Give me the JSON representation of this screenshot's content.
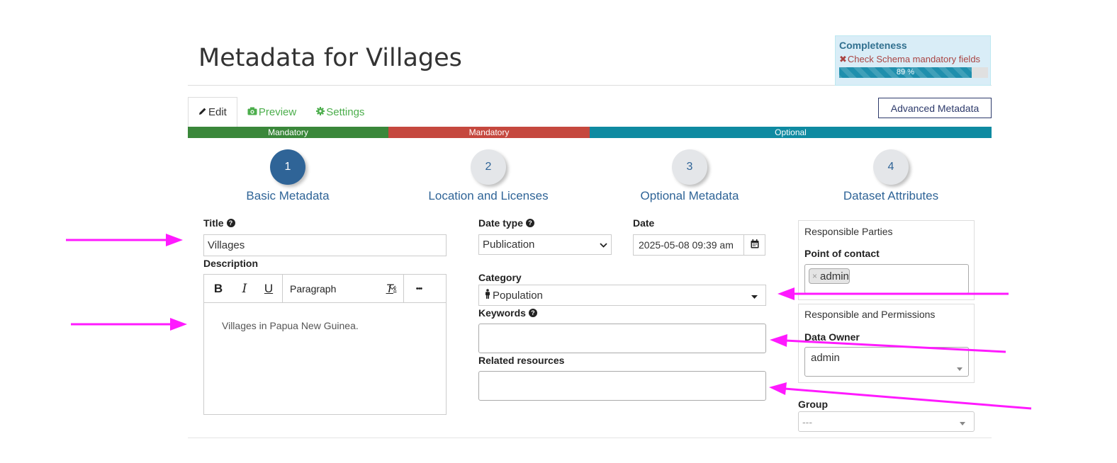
{
  "page": {
    "title": "Metadata for Villages"
  },
  "completeness": {
    "title": "Completeness",
    "check_text": "Check Schema mandatory fields",
    "percent": 89,
    "percent_label": "89 %"
  },
  "tabs": [
    {
      "label": "Edit",
      "icon": "pencil-icon"
    },
    {
      "label": "Preview",
      "icon": "camera-icon"
    },
    {
      "label": "Settings",
      "icon": "gear-icon"
    }
  ],
  "advanced_button": "Advanced Metadata",
  "requirement_bar": [
    {
      "label": "Mandatory",
      "color": "#3a873a"
    },
    {
      "label": "Mandatory",
      "color": "#c5483e"
    },
    {
      "label": "Optional",
      "color": "#0e8aa1"
    }
  ],
  "steps": [
    {
      "number": "1",
      "label": "Basic Metadata",
      "active": true
    },
    {
      "number": "2",
      "label": "Location and Licenses",
      "active": false
    },
    {
      "number": "3",
      "label": "Optional Metadata",
      "active": false
    },
    {
      "number": "4",
      "label": "Dataset Attributes",
      "active": false
    }
  ],
  "form": {
    "title_label": "Title",
    "title_value": "Villages",
    "description_label": "Description",
    "editor": {
      "format": "Paragraph",
      "bold": "B",
      "italic": "I",
      "underline": "U",
      "clear": "T",
      "more": "•••",
      "content": "Villages in Papua New Guinea."
    },
    "date_type_label": "Date type",
    "date_type_value": "Publication",
    "date_label": "Date",
    "date_value": "2025-05-08 09:39 am",
    "category_label": "Category",
    "category_value": "Population",
    "keywords_label": "Keywords",
    "related_label": "Related resources",
    "responsible_parties_title": "Responsible Parties",
    "point_of_contact_label": "Point of contact",
    "point_of_contact_tag": "admin",
    "responsible_permissions_title": "Responsible and Permissions",
    "data_owner_label": "Data Owner",
    "data_owner_value": "admin",
    "group_label": "Group",
    "group_value": "---"
  },
  "colors": {
    "accent_blue": "#2f6497",
    "tab_green": "#4cae4c",
    "annotation_arrow": "#ff1aff"
  }
}
